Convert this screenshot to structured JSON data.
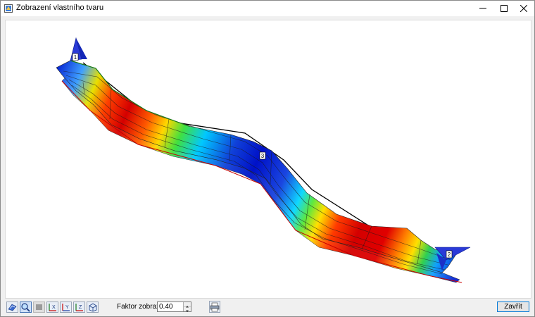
{
  "window": {
    "title": "Zobrazení vlastního tvaru"
  },
  "viewer": {
    "node_labels": [
      "1",
      "3",
      "2"
    ]
  },
  "toolbar": {
    "buttons": [
      {
        "icon": "view-model-icon"
      },
      {
        "icon": "zoom-icon",
        "active": true
      },
      {
        "icon": "fill-icon",
        "disabled": true
      },
      {
        "icon": "view-xz-icon"
      },
      {
        "icon": "view-xy-icon"
      },
      {
        "icon": "view-yz-icon"
      },
      {
        "icon": "view-3d-icon"
      }
    ],
    "print_icon": "print-icon"
  },
  "factor": {
    "label": "Faktor zobrazení:",
    "value": "0.40"
  },
  "close_label": "Zavřít",
  "colors": {
    "accent": "#0078d7",
    "red": "#d40000",
    "blue": "#0011c8"
  }
}
